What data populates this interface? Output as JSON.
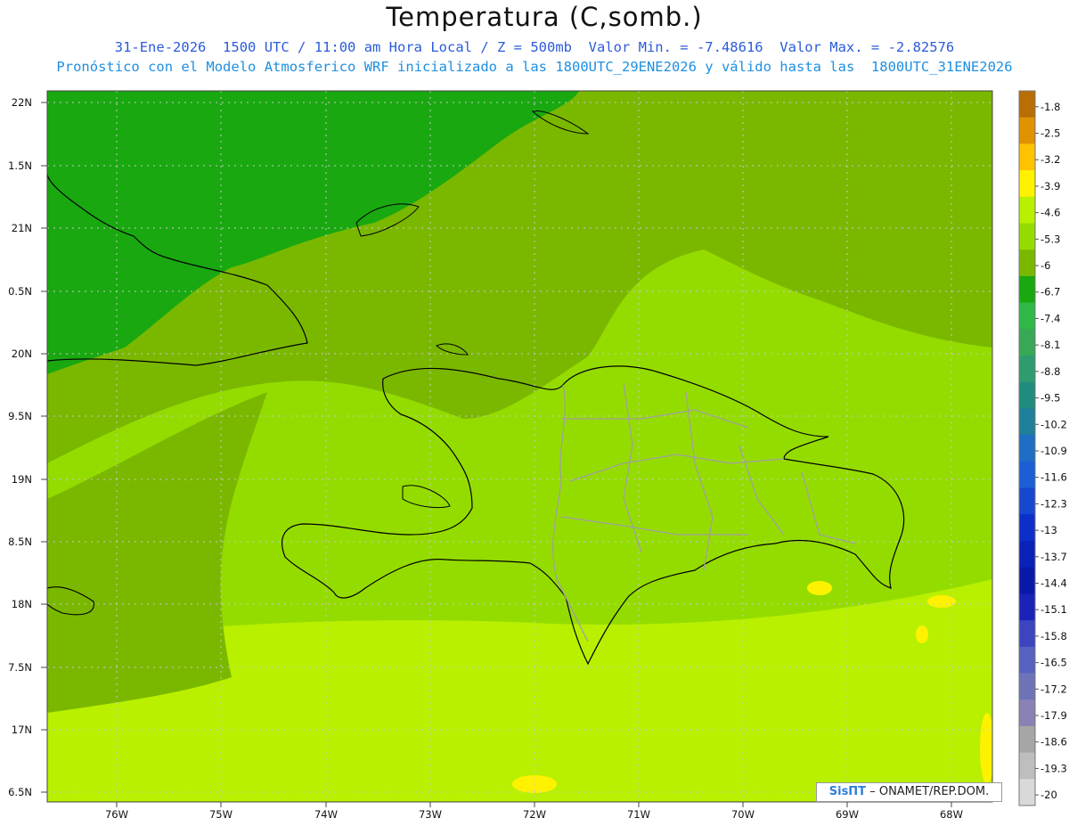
{
  "header": {
    "title": "Temperatura (C,somb.)",
    "line1": "31-Ene-2026  1500 UTC / 11:00 am Hora Local / Z = 500mb  Valor Min. = -7.48616  Valor Max. = -2.82576",
    "line2": "Pronóstico con el Modelo Atmosferico WRF inicializado a las 1800UTC_29ENE2026 y válido hasta las  1800UTC_31ENE2026"
  },
  "map": {
    "lat_labels": [
      "22N",
      "1.5N",
      "21N",
      "0.5N",
      "20N",
      "9.5N",
      "19N",
      "8.5N",
      "18N",
      "7.5N",
      "17N",
      "6.5N"
    ],
    "lon_labels": [
      "76W",
      "75W",
      "74W",
      "73W",
      "72W",
      "71W",
      "70W",
      "69W",
      "68W"
    ]
  },
  "legend": {
    "labels": [
      "-1.8",
      "-2.5",
      "-3.2",
      "-3.9",
      "-4.6",
      "-5.3",
      "-6",
      "-6.7",
      "-7.4",
      "-8.1",
      "-8.8",
      "-9.5",
      "-10.2",
      "-10.9",
      "-11.6",
      "-12.3",
      "-13",
      "-13.7",
      "-14.4",
      "-15.1",
      "-15.8",
      "-16.5",
      "-17.2",
      "-17.9",
      "-18.6",
      "-19.3",
      "-20"
    ],
    "colors": [
      "#b86e00",
      "#e09200",
      "#fdc200",
      "#fff200",
      "#b8f000",
      "#94dc00",
      "#7ab800",
      "#19a810",
      "#2fb845",
      "#39a856",
      "#2e9c6e",
      "#1f8c7e",
      "#207f9a",
      "#1d6ec4",
      "#1b5ed6",
      "#1547d0",
      "#0d2fc9",
      "#0a22b8",
      "#0a18a8",
      "#1a22b8",
      "#3c44c0",
      "#5661c0",
      "#6e73b8",
      "#8a82b4",
      "#a6a6a6",
      "#bebebe",
      "#d9d9d9"
    ]
  },
  "colors": {
    "field_dark": "#19a810",
    "field_mid": "#7ab800",
    "field_light": "#94dc00",
    "field_lightest": "#b8f000",
    "field_yellow": "#fff200",
    "coast": "#000000",
    "provinces": "#a0a0a0"
  },
  "credit": {
    "logo": "SisПT",
    "text": "– ONAMET/REP.DOM."
  }
}
